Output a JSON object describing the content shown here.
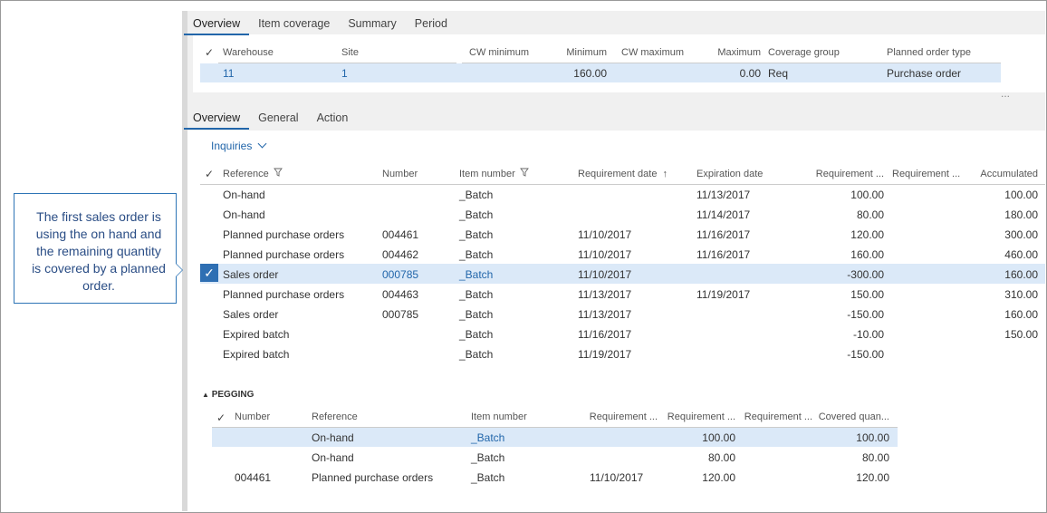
{
  "top_tabs": [
    "Overview",
    "Item coverage",
    "Summary",
    "Period"
  ],
  "coverage": {
    "headers": [
      "Warehouse",
      "Site",
      "CW minimum",
      "Minimum",
      "CW maximum",
      "Maximum",
      "Coverage group",
      "Planned order type"
    ],
    "row": {
      "warehouse": "11",
      "site": "1",
      "cw_minimum": "",
      "minimum": "160.00",
      "cw_maximum": "",
      "maximum": "0.00",
      "coverage_group": "Req",
      "planned_order_type": "Purchase order"
    },
    "more": "..."
  },
  "lower_tabs": [
    "Overview",
    "General",
    "Action"
  ],
  "inquiries_label": "Inquiries",
  "transactions": {
    "headers": [
      "Reference",
      "Number",
      "Item number",
      "Requirement date",
      "Expiration date",
      "Requirement ...",
      "Requirement ...",
      "Accumulated"
    ],
    "rows": [
      {
        "reference": "On-hand",
        "number": "",
        "item": "_Batch",
        "req_date": "",
        "exp_date": "11/13/2017",
        "qty": "100.00",
        "qty2": "",
        "accum": "100.00"
      },
      {
        "reference": "On-hand",
        "number": "",
        "item": "_Batch",
        "req_date": "",
        "exp_date": "11/14/2017",
        "qty": "80.00",
        "qty2": "",
        "accum": "180.00"
      },
      {
        "reference": "Planned purchase orders",
        "number": "004461",
        "item": "_Batch",
        "req_date": "11/10/2017",
        "exp_date": "11/16/2017",
        "qty": "120.00",
        "qty2": "",
        "accum": "300.00"
      },
      {
        "reference": "Planned purchase orders",
        "number": "004462",
        "item": "_Batch",
        "req_date": "11/10/2017",
        "exp_date": "11/16/2017",
        "qty": "160.00",
        "qty2": "",
        "accum": "460.00"
      },
      {
        "reference": "Sales order",
        "number": "000785",
        "item": "_Batch",
        "req_date": "11/10/2017",
        "exp_date": "",
        "qty": "-300.00",
        "qty2": "",
        "accum": "160.00"
      },
      {
        "reference": "Planned purchase orders",
        "number": "004463",
        "item": "_Batch",
        "req_date": "11/13/2017",
        "exp_date": "11/19/2017",
        "qty": "150.00",
        "qty2": "",
        "accum": "310.00"
      },
      {
        "reference": "Sales order",
        "number": "000785",
        "item": "_Batch",
        "req_date": "11/13/2017",
        "exp_date": "",
        "qty": "-150.00",
        "qty2": "",
        "accum": "160.00"
      },
      {
        "reference": "Expired batch",
        "number": "",
        "item": "_Batch",
        "req_date": "11/16/2017",
        "exp_date": "",
        "qty": "-10.00",
        "qty2": "",
        "accum": "150.00"
      },
      {
        "reference": "Expired batch",
        "number": "",
        "item": "_Batch",
        "req_date": "11/19/2017",
        "exp_date": "",
        "qty": "-150.00",
        "qty2": "",
        "accum": ""
      }
    ]
  },
  "pegging": {
    "title": "PEGGING",
    "headers": [
      "Number",
      "Reference",
      "Item number",
      "Requirement ...",
      "Requirement ...",
      "Requirement ...",
      "Covered quan..."
    ],
    "rows": [
      {
        "number": "",
        "reference": "On-hand",
        "item": "_Batch",
        "r1": "",
        "r2": "100.00",
        "r3": "",
        "covered": "100.00"
      },
      {
        "number": "",
        "reference": "On-hand",
        "item": "_Batch",
        "r1": "",
        "r2": "80.00",
        "r3": "",
        "covered": "80.00"
      },
      {
        "number": "004461",
        "reference": "Planned purchase orders",
        "item": "_Batch",
        "r1": "11/10/2017",
        "r2": "120.00",
        "r3": "",
        "covered": "120.00"
      }
    ]
  },
  "callout": "The first sales order is using the  on hand and the remaining quantity is covered by a planned order.",
  "colors": {
    "accent": "#2266aa",
    "selected_row": "#dbe9f8",
    "callout_border": "#2e75b6"
  }
}
